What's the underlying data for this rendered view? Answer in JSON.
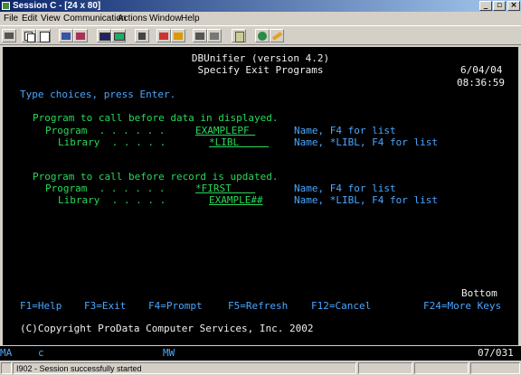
{
  "window": {
    "title": "Session C - [24 x 80]",
    "controls": {
      "minimize": "_",
      "restore": "▫",
      "close": "×"
    }
  },
  "menu": [
    "File",
    "Edit",
    "View",
    "Communication",
    "Actions",
    "Window",
    "Help"
  ],
  "toolbar_icons": [
    "print-screen-icon",
    "copy-icon",
    "paste-icon",
    "send-icon",
    "receive-icon",
    "display-icon",
    "keypad-icon",
    "macro-icon",
    "record-icon",
    "play-icon",
    "stop-icon",
    "settings-icon",
    "clipboard-icon",
    "globe-icon",
    "edit-icon"
  ],
  "terminal": {
    "app_title": "DBUnifier (version 4.2)",
    "screen_title": "Specify Exit Programs",
    "date": "6/04/04",
    "time": "08:36:59",
    "instructions": "Type choices, press Enter.",
    "section1": {
      "heading": "Program to call before data in displayed.",
      "program_label": "Program  . . . . . .",
      "program_value": "EXAMPLEPF ",
      "program_hint": "Name, F4 for list",
      "library_label": "Library  . . . . .",
      "library_value": "*LIBL     ",
      "library_hint": "Name, *LIBL, F4 for list"
    },
    "section2": {
      "heading": "Program to call before record is updated.",
      "program_label": "Program  . . . . . .",
      "program_value": "*FIRST    ",
      "program_hint": "Name, F4 for list",
      "library_label": "Library  . . . . .",
      "library_value": "EXAMPLE##",
      "library_hint": "Name, *LIBL, F4 for list"
    },
    "bottom": "Bottom",
    "fkeys": [
      "F1=Help",
      "F3=Exit",
      "F4=Prompt",
      "F5=Refresh",
      "F12=Cancel",
      "F24=More Keys"
    ],
    "copyright": "(C)Copyright ProData Computer Services, Inc. 2002"
  },
  "oia": {
    "left": "MA",
    "indicator": "c",
    "mode": "MW",
    "cursor": "07/031"
  },
  "statusbar": {
    "message": "I902 - Session successfully started"
  },
  "colors": {
    "accent_blue": "#4aa6ff",
    "text_green": "#29d85a",
    "terminal_bg": "#000000"
  }
}
